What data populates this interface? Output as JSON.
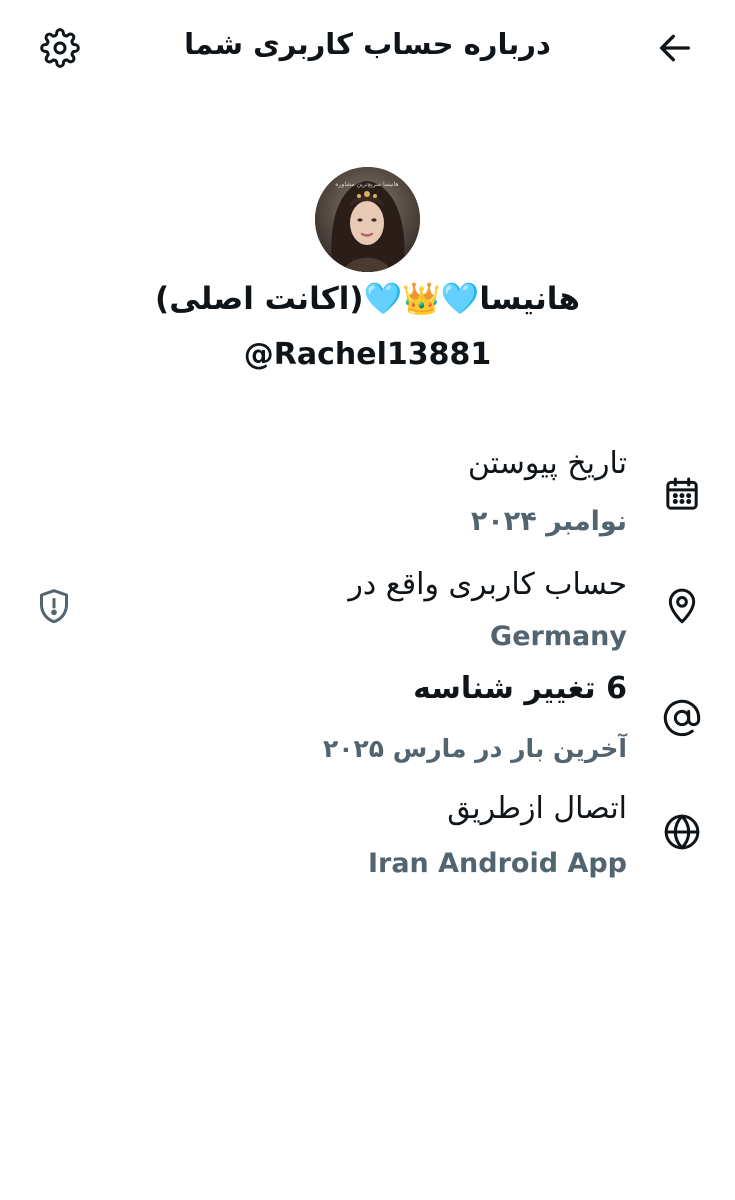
{
  "header": {
    "title": "درباره حساب کاربری شما",
    "settings_icon": "gear-icon",
    "back_icon": "arrow-left-icon"
  },
  "profile": {
    "display_name": "هانیسا🩵👑🩵(اکانت اصلی)",
    "username": "@Rachel13881",
    "avatar_watermark": "هانیسا سریع‌ترین مشاوره"
  },
  "rows": [
    {
      "icon": "calendar-icon",
      "label": "تاریخ پیوستن",
      "value": "نوامبر ۲۰۲۴"
    },
    {
      "icon": "location-pin-icon",
      "label": "حساب کاربری واقع در",
      "value": "Germany"
    },
    {
      "icon": "at-sign-icon",
      "label": "6 تغییر شناسه",
      "value": "آخرین بار در مارس ۲۰۲۵"
    },
    {
      "icon": "globe-icon",
      "label": "اتصال ازطریق",
      "value": "Iran Android App"
    }
  ],
  "side_icon": "shield-alert-icon",
  "colors": {
    "text_primary": "#0f1419",
    "text_secondary": "#536471",
    "background": "#ffffff"
  }
}
